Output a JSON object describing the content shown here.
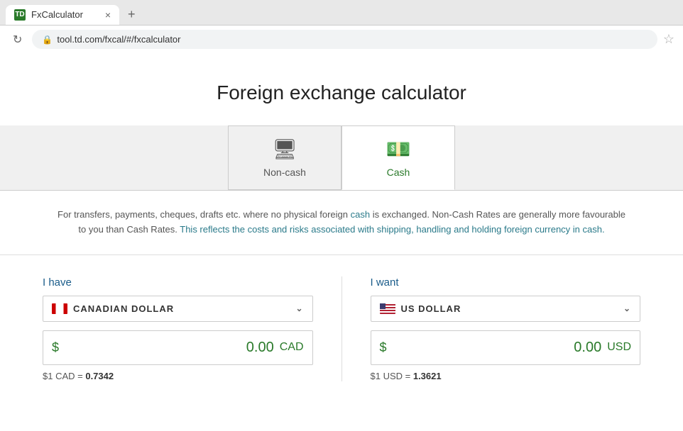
{
  "browser": {
    "tab_favicon": "TD",
    "tab_title": "FxCalculator",
    "tab_close": "×",
    "new_tab": "+",
    "url": "tool.td.com/fxcal/#/fxcalculator",
    "back_btn": "↺",
    "star": "☆"
  },
  "page": {
    "title": "Foreign exchange calculator"
  },
  "tabs": [
    {
      "id": "noncash",
      "label": "Non-cash",
      "icon": "💻",
      "active": false
    },
    {
      "id": "cash",
      "label": "Cash",
      "icon": "💵",
      "active": true
    }
  ],
  "info": {
    "text1": "For transfers, payments, cheques, drafts etc. where no physical foreign cash is exchanged. Non-Cash Rates are generally more favourable to you than Cash Rates.",
    "text2": "This reflects the costs and risks associated with shipping, handling and holding foreign currency in cash."
  },
  "ihave": {
    "label": "I have",
    "currency_name": "CANADIAN DOLLAR",
    "amount_label": "$",
    "amount_value": "0.00",
    "amount_currency": "CAD",
    "rate_label": "$1 CAD = ",
    "rate_value": "0.7342"
  },
  "iwant": {
    "label": "I want",
    "currency_name": "US DOLLAR",
    "amount_label": "$",
    "amount_value": "0.00",
    "amount_currency": "USD",
    "rate_label": "$1 USD = ",
    "rate_value": "1.3621"
  }
}
